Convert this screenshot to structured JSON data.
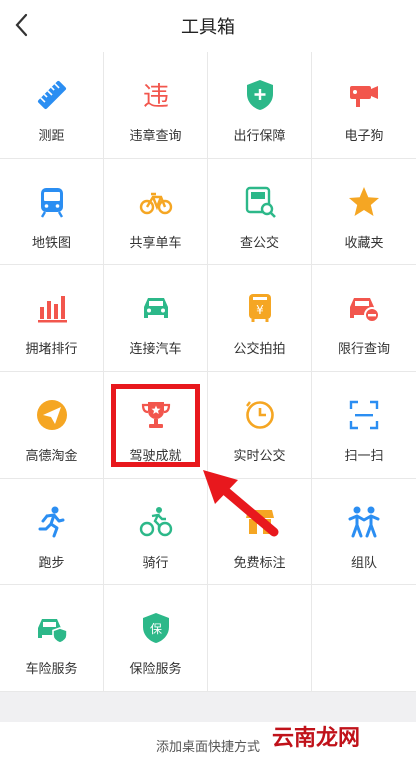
{
  "header": {
    "title": "工具箱"
  },
  "tools": [
    {
      "label": "测距",
      "icon": "ruler-icon"
    },
    {
      "label": "违章查询",
      "icon": "violation-icon"
    },
    {
      "label": "出行保障",
      "icon": "shield-plus-icon"
    },
    {
      "label": "电子狗",
      "icon": "camera-icon"
    },
    {
      "label": "地铁图",
      "icon": "subway-icon"
    },
    {
      "label": "共享单车",
      "icon": "bicycle-icon"
    },
    {
      "label": "查公交",
      "icon": "bus-search-icon"
    },
    {
      "label": "收藏夹",
      "icon": "star-icon"
    },
    {
      "label": "拥堵排行",
      "icon": "bar-chart-icon"
    },
    {
      "label": "连接汽车",
      "icon": "car-icon"
    },
    {
      "label": "公交拍拍",
      "icon": "bus-yuan-icon"
    },
    {
      "label": "限行查询",
      "icon": "car-restrict-icon"
    },
    {
      "label": "高德淘金",
      "icon": "paper-plane-icon"
    },
    {
      "label": "驾驶成就",
      "icon": "trophy-icon"
    },
    {
      "label": "实时公交",
      "icon": "clock-icon"
    },
    {
      "label": "扫一扫",
      "icon": "scan-icon"
    },
    {
      "label": "跑步",
      "icon": "runner-icon"
    },
    {
      "label": "骑行",
      "icon": "cyclist-icon"
    },
    {
      "label": "免费标注",
      "icon": "shop-icon"
    },
    {
      "label": "组队",
      "icon": "team-icon"
    },
    {
      "label": "车险服务",
      "icon": "car-insurance-icon"
    },
    {
      "label": "保险服务",
      "icon": "insurance-icon"
    }
  ],
  "footer": {
    "label": "添加桌面快捷方式"
  },
  "watermark": "云南龙网",
  "colors": {
    "accent_red": "#e8181d",
    "blue": "#2b8ef2",
    "green": "#2cb889",
    "orange": "#f5a623",
    "red": "#f2564d"
  }
}
